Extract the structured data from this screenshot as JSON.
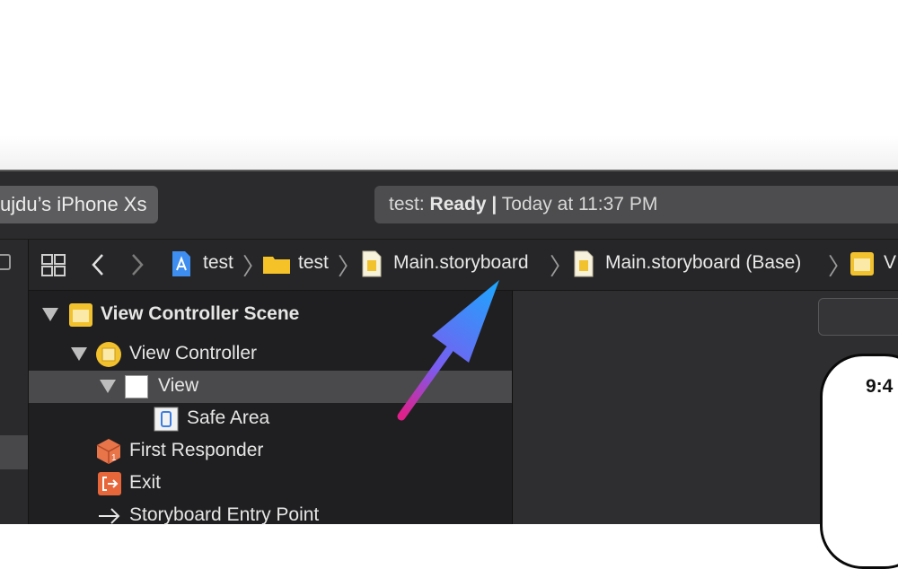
{
  "toolbar": {
    "device": "ujdu’s iPhone Xs",
    "status_project": "test:",
    "status_state": "Ready",
    "status_sep": "|",
    "status_time": "Today at 11:37 PM"
  },
  "jumpbar": {
    "crumbs": [
      {
        "label": "test",
        "icon": "project-icon"
      },
      {
        "label": "test",
        "icon": "folder-icon"
      },
      {
        "label": "Main.storyboard",
        "icon": "storyboard-file-icon"
      },
      {
        "label": "Main.storyboard (Base)",
        "icon": "storyboard-file-icon"
      },
      {
        "label": "V",
        "icon": "scene-icon"
      }
    ]
  },
  "outline": {
    "items": [
      {
        "label": "View Controller Scene",
        "icon": "scene-icon",
        "expanded": true
      },
      {
        "label": "View Controller",
        "icon": "view-controller-icon",
        "expanded": true
      },
      {
        "label": "View",
        "icon": "view-icon",
        "expanded": true,
        "selected": true
      },
      {
        "label": "Safe Area",
        "icon": "safe-area-icon"
      },
      {
        "label": "First Responder",
        "icon": "first-responder-icon"
      },
      {
        "label": "Exit",
        "icon": "exit-icon"
      },
      {
        "label": "Storyboard Entry Point",
        "icon": "entry-point-arrow-icon"
      }
    ]
  },
  "canvas": {
    "phone_time": "9:4"
  },
  "colors": {
    "annotation_arrow_start": "#e0208a",
    "annotation_arrow_end": "#1aa8ff",
    "selected_row": "#4a4a4c",
    "scene_icon": "#f2c12e"
  }
}
